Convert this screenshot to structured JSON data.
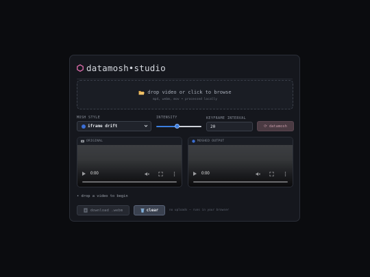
{
  "app": {
    "title": "datamosh•studio"
  },
  "dropzone": {
    "main_text": "drop video or click to browse",
    "sub_text": "mp4, webm, mov • processed locally"
  },
  "controls": {
    "mosh_style_label": "MOSH STYLE",
    "mosh_style_value": "iframe drift",
    "intensity_label": "INTENSITY",
    "intensity_value": 0.45,
    "keyframe_label": "KEYFRAME INTERVAL",
    "keyframe_value": "20",
    "mosh_button": "⟳ datamosh"
  },
  "panels": {
    "original": {
      "label": "ORIGINAL",
      "time": "0:00"
    },
    "moshed": {
      "label": "MOSHED OUTPUT",
      "time": "0:00"
    }
  },
  "status": {
    "text": "• drop a video to begin"
  },
  "actions": {
    "download": "download .webm",
    "clear": "clear",
    "note": "no uploads — runs in your browser"
  },
  "colors": {
    "accent_logo": "#e46fb0",
    "select_dot": "#3b6fd6",
    "slider": "#3c7fe0",
    "mosh_button_bg": "#4a3a42"
  },
  "icons": {
    "logo": "hexagon-icon",
    "dropzone": "folder-open-icon",
    "select": "blue-circle-icon",
    "original_panel": "film-icon",
    "moshed_panel": "blue-circle-icon",
    "download": "download-icon",
    "clear": "trash-icon"
  }
}
